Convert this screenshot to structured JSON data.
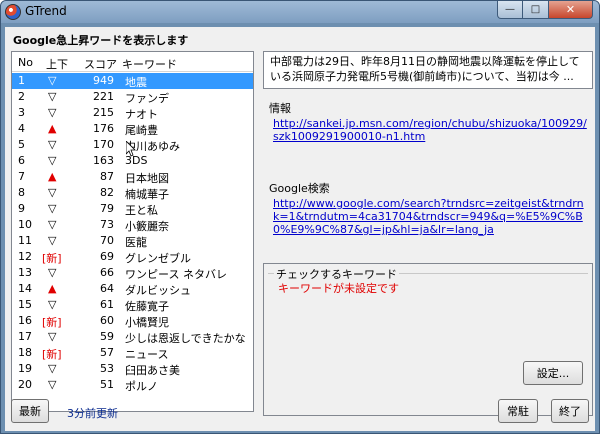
{
  "window": {
    "title": "GTrend",
    "minimize": "—",
    "maximize": "□",
    "close": "✕"
  },
  "header": {
    "label": "Google急上昇ワードを表示します"
  },
  "list": {
    "columns": {
      "no": "No",
      "updown": "上下",
      "score": "スコア",
      "keyword": "キーワード"
    },
    "rows": [
      {
        "no": "1",
        "mark": "▽",
        "score": "949",
        "keyword": "地震"
      },
      {
        "no": "2",
        "mark": "▽",
        "score": "221",
        "keyword": "ファンデ"
      },
      {
        "no": "3",
        "mark": "▽",
        "score": "215",
        "keyword": "ナオト"
      },
      {
        "no": "4",
        "mark": "▲",
        "score": "176",
        "keyword": "尾崎豊"
      },
      {
        "no": "5",
        "mark": "▽",
        "score": "170",
        "keyword": "中川あゆみ"
      },
      {
        "no": "6",
        "mark": "▽",
        "score": "163",
        "keyword": "3DS"
      },
      {
        "no": "7",
        "mark": "▲",
        "score": "87",
        "keyword": "日本地図"
      },
      {
        "no": "8",
        "mark": "▽",
        "score": "82",
        "keyword": "楠城華子"
      },
      {
        "no": "9",
        "mark": "▽",
        "score": "79",
        "keyword": "王と私"
      },
      {
        "no": "10",
        "mark": "▽",
        "score": "73",
        "keyword": "小籔麗奈"
      },
      {
        "no": "11",
        "mark": "▽",
        "score": "70",
        "keyword": "医龍"
      },
      {
        "no": "12",
        "mark": "[新]",
        "score": "69",
        "keyword": "グレンゼブル"
      },
      {
        "no": "13",
        "mark": "▽",
        "score": "66",
        "keyword": "ワンピース ネタバレ"
      },
      {
        "no": "14",
        "mark": "▲",
        "score": "64",
        "keyword": "ダルビッシュ"
      },
      {
        "no": "15",
        "mark": "▽",
        "score": "61",
        "keyword": "佐藤寛子"
      },
      {
        "no": "16",
        "mark": "[新]",
        "score": "60",
        "keyword": "小橋賢児"
      },
      {
        "no": "17",
        "mark": "▽",
        "score": "59",
        "keyword": "少しは恩返しできたかな"
      },
      {
        "no": "18",
        "mark": "[新]",
        "score": "57",
        "keyword": "ニュース"
      },
      {
        "no": "19",
        "mark": "▽",
        "score": "53",
        "keyword": "臼田あさ美"
      },
      {
        "no": "20",
        "mark": "▽",
        "score": "51",
        "keyword": "ポルノ"
      }
    ]
  },
  "summary": {
    "text": "中部電力は29日、昨年8月11日の静岡地震以降運転を停止している浜岡原子力発電所5号機(御前崎市)について、当初は今 ..."
  },
  "info": {
    "title": "情報",
    "link": "http://sankei.jp.msn.com/region/chubu/shizuoka/100929/szk1009291900010-n1.htm"
  },
  "google": {
    "title": "Google検索",
    "link": "http://www.google.com/search?trndsrc=zeitgeist&trndrnk=1&trndutm=4ca31704&trndscr=949&q=%E5%9C%B0%E9%9C%87&gl=jp&hl=ja&lr=lang_ja"
  },
  "check": {
    "title": "チェックするキーワード",
    "status": "キーワードが未設定です"
  },
  "buttons": {
    "settings": "設定...",
    "refresh": "最新",
    "resident": "常駐",
    "exit": "終了"
  },
  "status": {
    "updated": "3分前更新"
  },
  "colors": {
    "selection": "#3399ff",
    "up": "#e00000",
    "link": "#0000cc"
  }
}
